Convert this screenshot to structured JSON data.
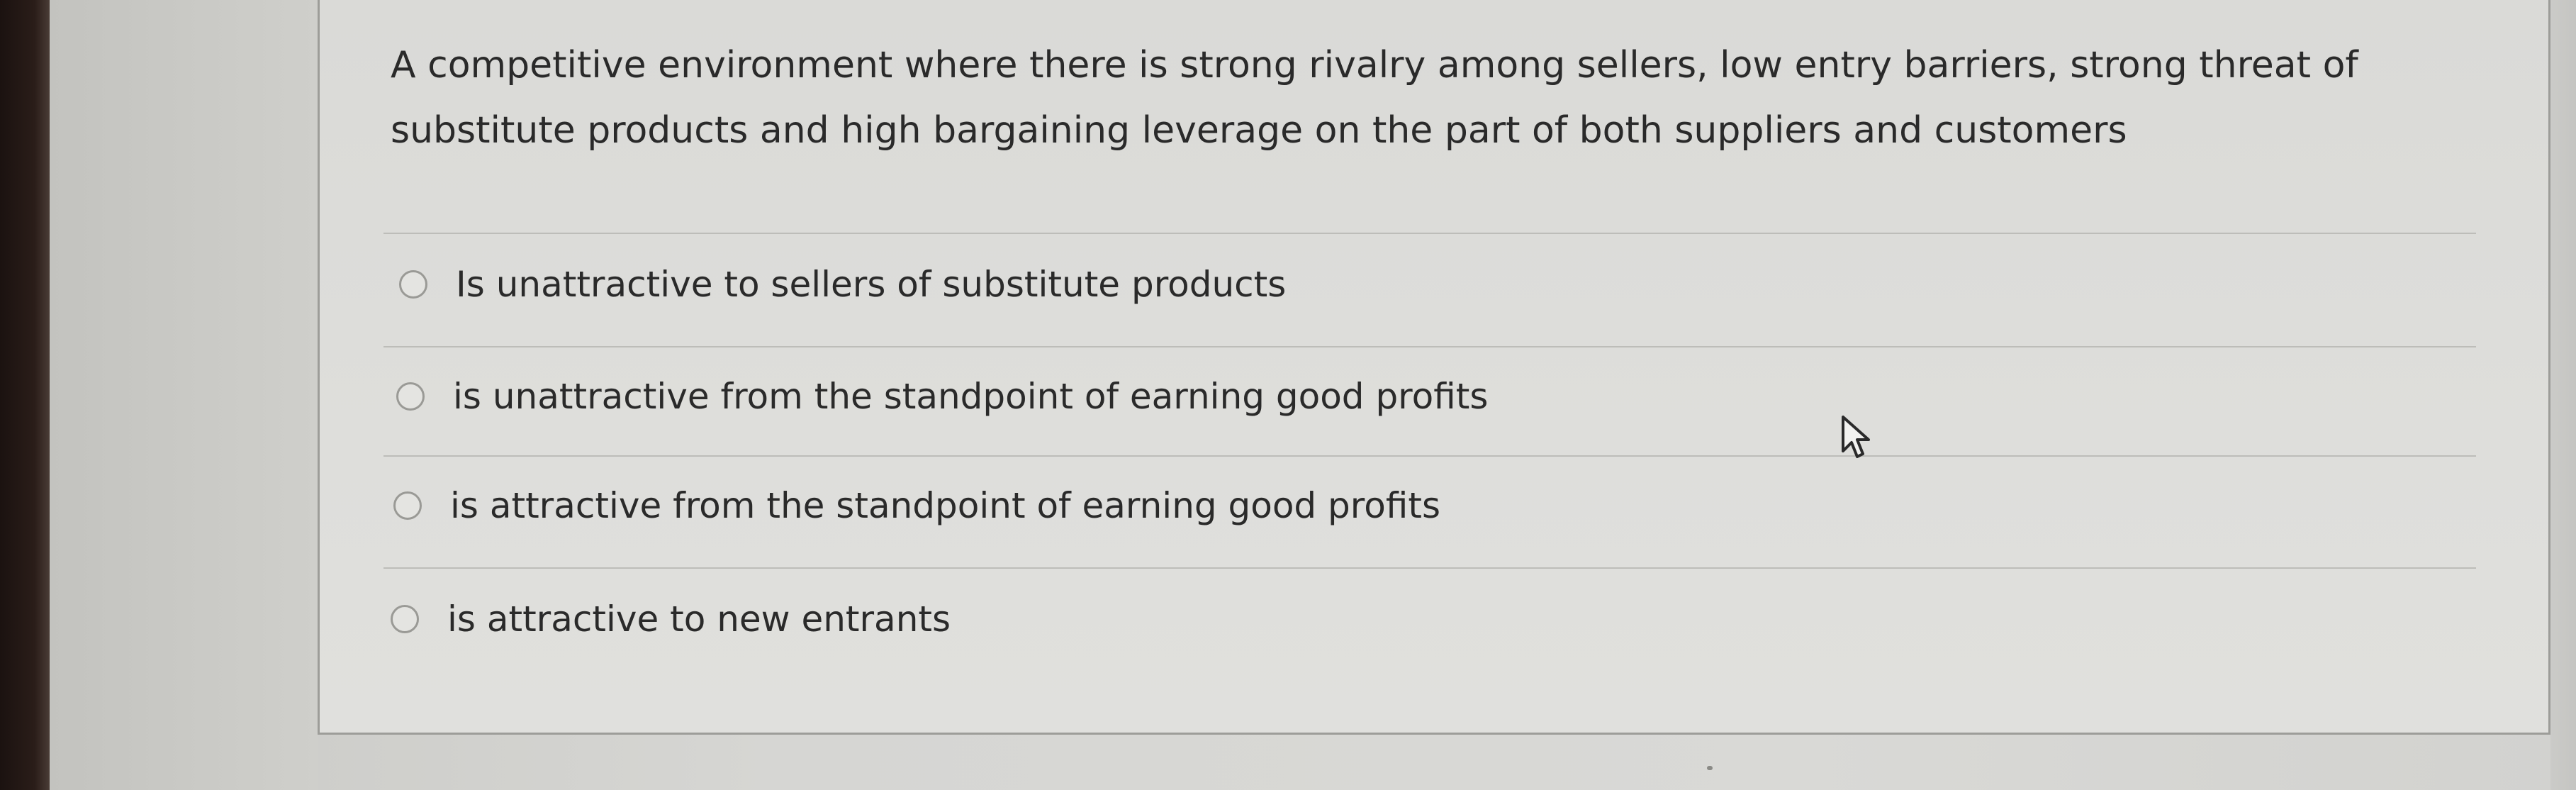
{
  "question": {
    "line1": "A competitive environment where there is strong rivalry among sellers, low entry barriers, strong threat of",
    "line2": "substitute products and high bargaining leverage on the part of both suppliers and customers"
  },
  "options": [
    {
      "label": "Is unattractive to sellers of substitute products",
      "selected": false
    },
    {
      "label": "is unattractive from the standpoint of earning good profits",
      "selected": false
    },
    {
      "label": "is attractive from the standpoint of earning good profits",
      "selected": false
    },
    {
      "label": "is attractive to new entrants",
      "selected": false
    }
  ],
  "icons": {
    "radio": "radio-button-icon",
    "cursor": "mouse-pointer-icon"
  },
  "colors": {
    "text": "#2a2a2a",
    "card_background": "#dededb",
    "card_border": "#9d9d99",
    "radio_border": "#9a9a96",
    "bezel": "#1b1210"
  }
}
